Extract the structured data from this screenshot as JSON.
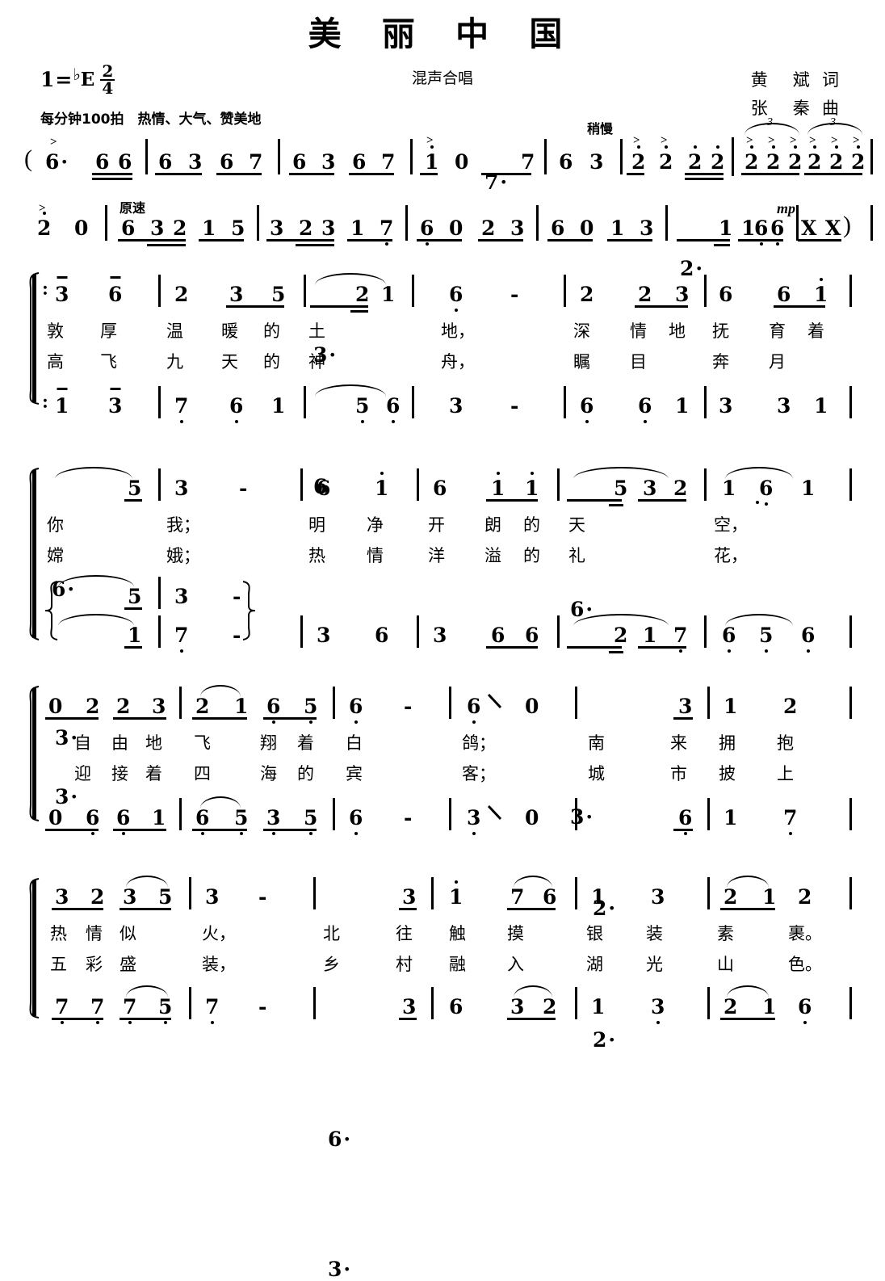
{
  "header": {
    "title": "美 丽 中 国",
    "subtitle": "混声合唱",
    "key_label_do": "1",
    "key_equals": "=",
    "key_flat": "♭",
    "key_letter": "E",
    "meter_num": "2",
    "meter_den": "4",
    "tempo": "每分钟100拍　热情、大气、赞美地",
    "lyricist": "黄　斌 词",
    "composer": "张　秦 曲"
  },
  "markers": {
    "slightly_slow": "稍慢",
    "original_tempo": "原速",
    "dynamic_mp": "mp",
    "triplet": "3",
    "accent": ">",
    "open_paren": "(",
    "close_paren": ")"
  },
  "intro": {
    "line1": [
      {
        "n": "6",
        "dot": true,
        "acc": true
      },
      {
        "n": "6",
        "beam": 2
      },
      {
        "n": "6",
        "beam": 2
      },
      {
        "n": "6",
        "beam": 1
      },
      {
        "n": "3",
        "beam": 1
      },
      {
        "n": "6",
        "beam": 1
      },
      {
        "n": "7",
        "beam": 1
      },
      {
        "n": "6",
        "beam": 1
      },
      {
        "n": "3",
        "beam": 1
      },
      {
        "n": "6",
        "beam": 1
      },
      {
        "n": "7",
        "beam": 1
      },
      {
        "n": "1",
        "oct": "up",
        "beam": 1
      },
      {
        "n": "0"
      },
      {
        "n": "7",
        "dot": true,
        "beam": 1
      },
      {
        "n": "7",
        "beam": 1
      },
      {
        "n": "6"
      },
      {
        "n": "3"
      },
      {
        "n": "2",
        "oct": "up",
        "acc": true
      },
      {
        "n": "2",
        "oct": "up",
        "acc": true
      },
      {
        "n": "2",
        "oct": "up"
      },
      {
        "n": "2",
        "oct": "up"
      },
      {
        "n": "2",
        "oct": "up",
        "acc": true
      },
      {
        "n": "2",
        "oct": "up",
        "acc": true
      },
      {
        "n": "2",
        "oct": "up",
        "acc": true
      },
      {
        "n": "2",
        "oct": "up",
        "acc": true
      },
      {
        "n": "2",
        "oct": "up",
        "acc": true
      },
      {
        "n": "2",
        "oct": "up",
        "acc": true
      }
    ],
    "line2": [
      {
        "n": "2",
        "oct": "up",
        "acc": true
      },
      {
        "n": "0"
      },
      {
        "n": "6"
      },
      {
        "n": "3"
      },
      {
        "n": "2"
      },
      {
        "n": "1"
      },
      {
        "n": "5"
      },
      {
        "n": "3"
      },
      {
        "n": "2"
      },
      {
        "n": "3"
      },
      {
        "n": "1"
      },
      {
        "n": "7",
        "oct": "dn"
      },
      {
        "n": "6",
        "oct": "dn"
      },
      {
        "n": "0"
      },
      {
        "n": "2"
      },
      {
        "n": "3"
      },
      {
        "n": "6"
      },
      {
        "n": "0"
      },
      {
        "n": "1"
      },
      {
        "n": "3"
      },
      {
        "n": "2",
        "dot": true
      },
      {
        "n": "1"
      },
      {
        "n": "1"
      },
      {
        "n": "6",
        "oct": "dn"
      },
      {
        "n": "6",
        "oct": "dn"
      },
      {
        "n": "X"
      },
      {
        "n": "X"
      }
    ]
  },
  "systems": [
    {
      "id": "system-1",
      "upper": [
        "3",
        "6",
        "2",
        "3",
        "5",
        "3·",
        "2",
        "1",
        "6",
        "-",
        "2",
        "2",
        "3",
        "6",
        "6",
        "1"
      ],
      "lower": [
        "1",
        "3",
        "7",
        "6",
        "1",
        "6·",
        "5",
        "6",
        "3",
        "-",
        "6",
        "6",
        "1",
        "3",
        "3",
        "1"
      ],
      "lyrics_v1": [
        "敦",
        "厚",
        "温",
        "暖",
        "的",
        "土",
        "地，",
        "深",
        "情",
        "地",
        "抚",
        "育",
        "着"
      ],
      "lyrics_v2": [
        "高",
        "飞",
        "九",
        "天",
        "的",
        "神",
        "舟，",
        "瞩",
        "目",
        "",
        "奔",
        "月",
        ""
      ]
    },
    {
      "id": "system-2",
      "upper": [
        "6·",
        "5",
        "3",
        "-",
        "6",
        "1",
        "6",
        "1",
        "1",
        "6·",
        "5",
        "3",
        "2",
        "1",
        "6",
        "1"
      ],
      "lower": [
        "3·",
        "5",
        "3",
        "-",
        "3",
        "6",
        "3",
        "6",
        "6",
        "3·",
        "2",
        "1",
        "7",
        "6",
        "5",
        "6"
      ],
      "lower2": [
        "3·",
        "1",
        "7",
        "-"
      ],
      "lyrics_v1": [
        "你",
        "我；",
        "明",
        "净",
        "开",
        "朗",
        "的",
        "天",
        "空，"
      ],
      "lyrics_v2": [
        "嫦",
        "娥；",
        "热",
        "情",
        "洋",
        "溢",
        "的",
        "礼",
        "花，"
      ]
    },
    {
      "id": "system-3",
      "upper": [
        "0",
        "2",
        "2",
        "3",
        "2",
        "1",
        "6",
        "5",
        "6",
        "-",
        "6",
        "0",
        "2·",
        "3",
        "1",
        "2"
      ],
      "lower": [
        "0",
        "6",
        "6",
        "1",
        "6",
        "5",
        "3",
        "5",
        "6",
        "-",
        "3",
        "0",
        "2·",
        "6",
        "1",
        "7"
      ],
      "lyrics_v1": [
        "自",
        "由",
        "地",
        "飞",
        "翔",
        "着",
        "白",
        "鸽；",
        "南",
        "来",
        "拥",
        "抱"
      ],
      "lyrics_v2": [
        "迎",
        "接",
        "着",
        "四",
        "海",
        "的",
        "宾",
        "客；",
        "城",
        "市",
        "披",
        "上"
      ]
    },
    {
      "id": "system-4",
      "upper": [
        "3",
        "2",
        "3",
        "5",
        "3",
        "-",
        "6·",
        "3",
        "1",
        "7",
        "6",
        "1",
        "3",
        "2",
        "1",
        "2"
      ],
      "lower": [
        "7",
        "7",
        "7",
        "5",
        "7",
        "-",
        "3·",
        "3",
        "6",
        "3",
        "2",
        "1",
        "3",
        "2",
        "1",
        "6"
      ],
      "lyrics_v1": [
        "热",
        "情",
        "似",
        "火，",
        "北",
        "往",
        "触",
        "摸",
        "银",
        "装",
        "素",
        "裹。"
      ],
      "lyrics_v2": [
        "五",
        "彩",
        "盛",
        "装，",
        "乡",
        "村",
        "融",
        "入",
        "湖",
        "光",
        "山",
        "色。"
      ]
    }
  ]
}
